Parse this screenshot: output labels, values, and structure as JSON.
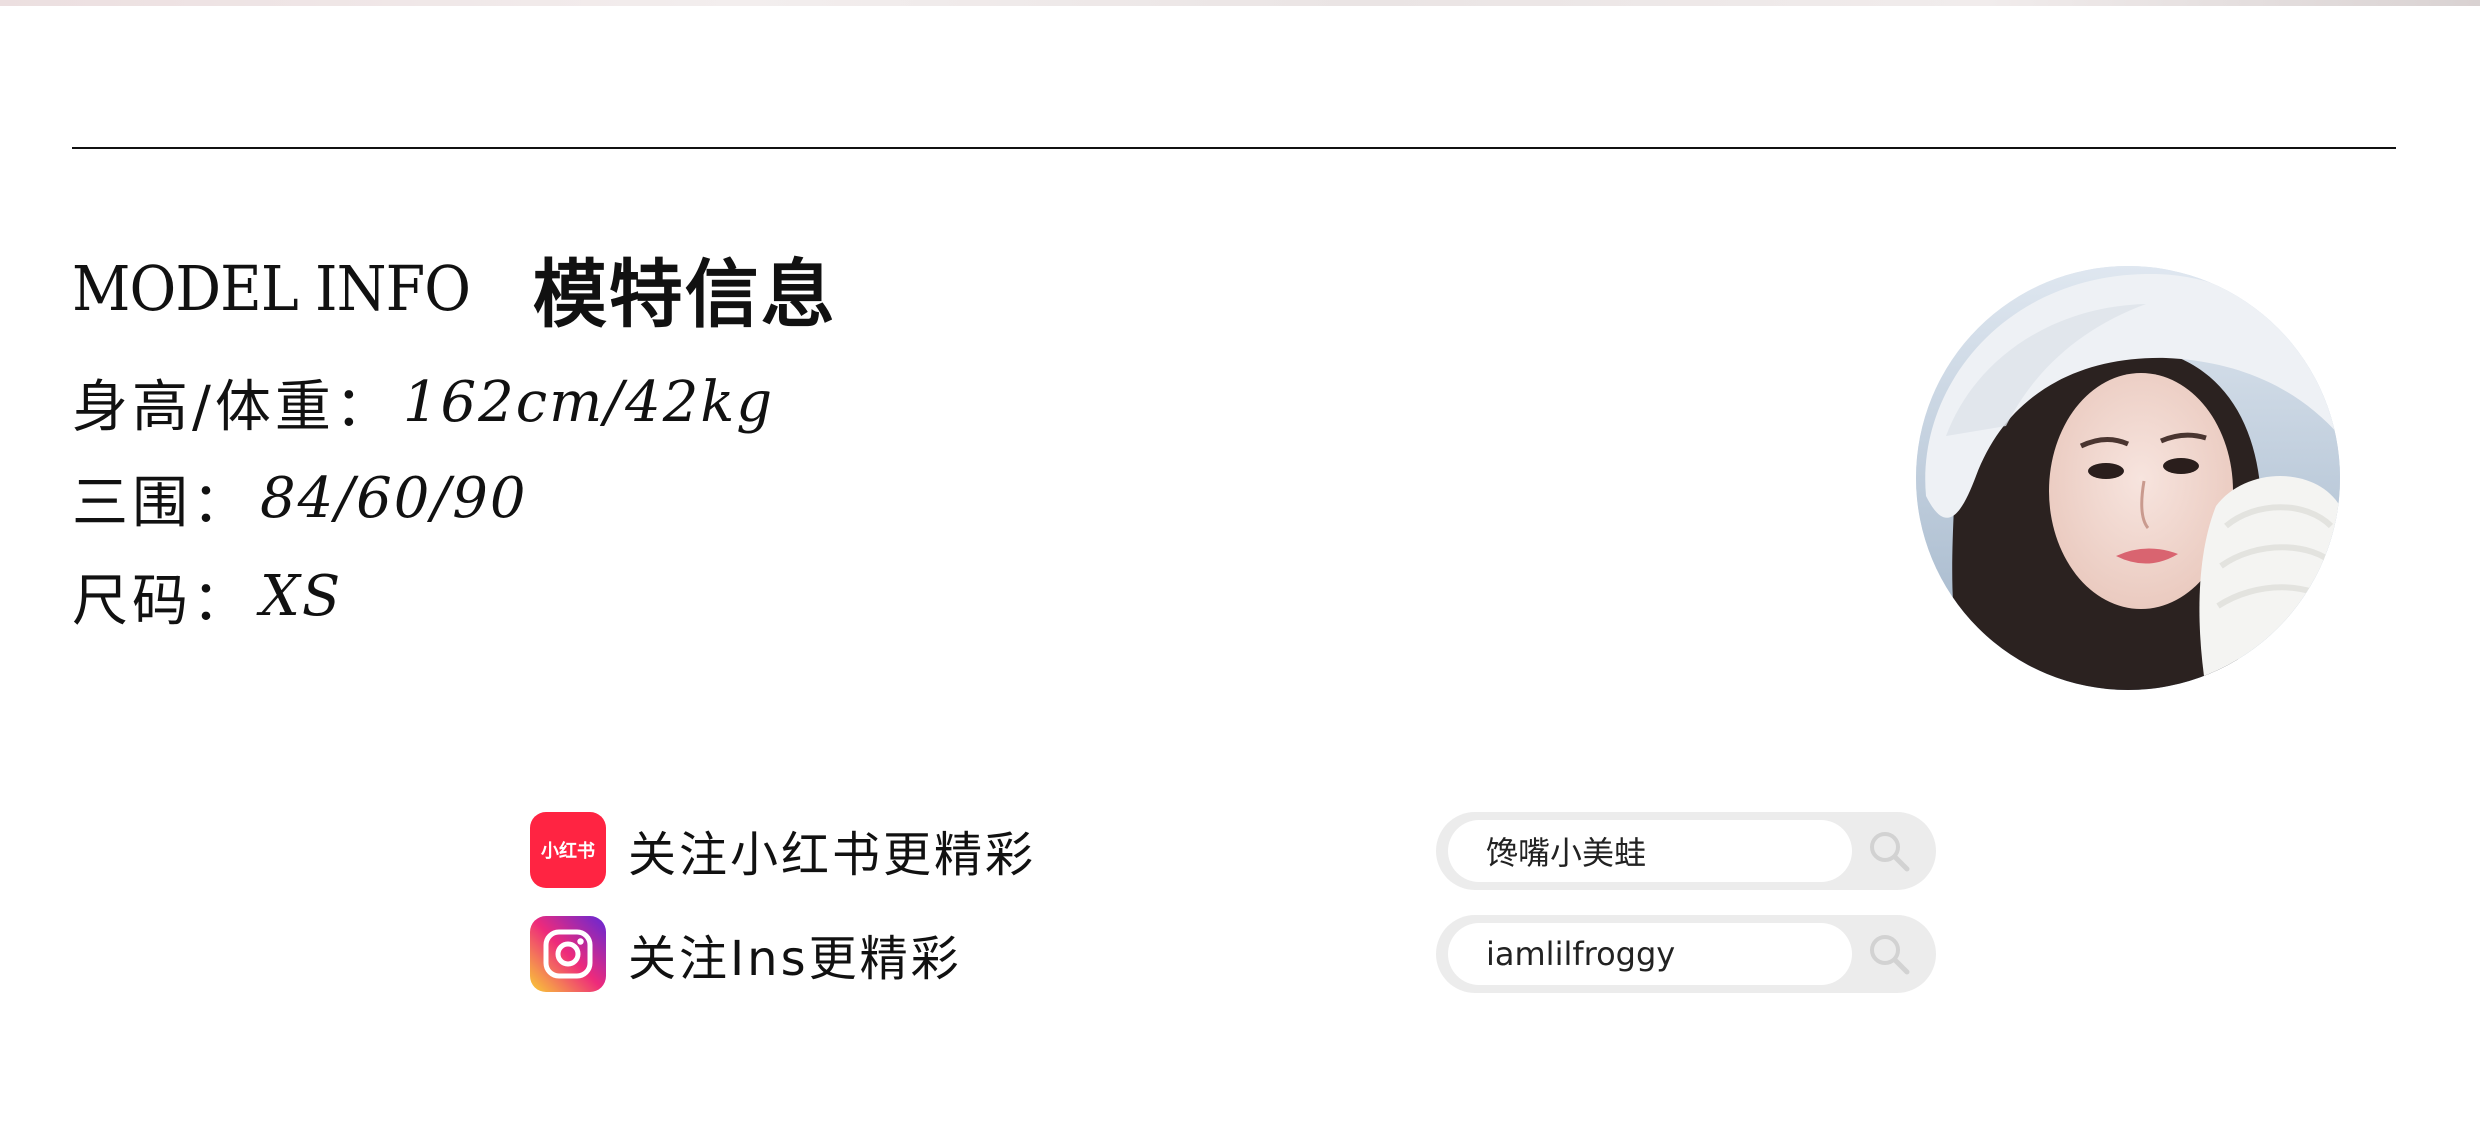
{
  "heading": {
    "en": "MODEL INFO",
    "cn": "模特信息"
  },
  "info": [
    {
      "label": "身高/体重：",
      "value": "162cm/42kg"
    },
    {
      "label": "三围：",
      "value": "84/60/90"
    },
    {
      "label": "尺码：",
      "value": "XS"
    }
  ],
  "social": [
    {
      "icon": "xiaohongshu-icon",
      "icon_text": "小红书",
      "text": "关注小红书更精彩",
      "handle": "馋嘴小美蛙"
    },
    {
      "icon": "instagram-icon",
      "text": "关注Ins更精彩",
      "handle": "iamlilfroggy"
    }
  ],
  "colors": {
    "xiaohongshu_red": "#ff2442",
    "rule": "#111111",
    "pill_bg": "#ececec"
  }
}
